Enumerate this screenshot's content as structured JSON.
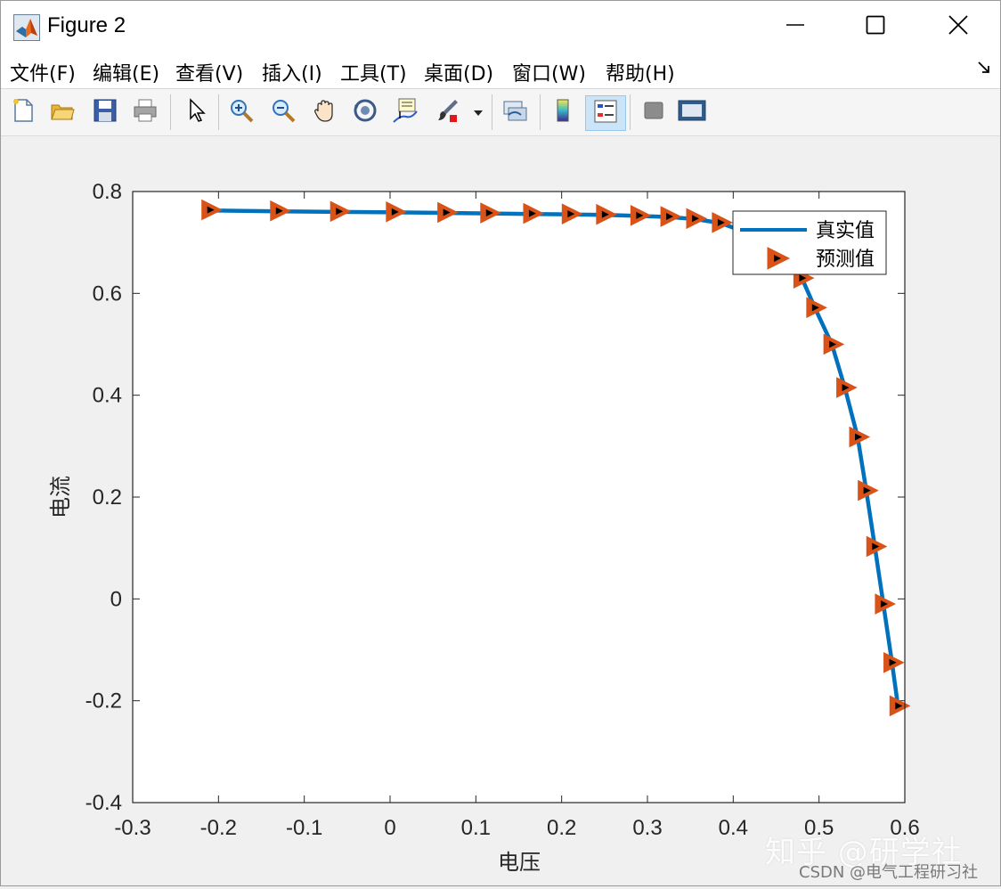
{
  "window": {
    "title": "Figure 2",
    "minimize_icon": "minimize-icon",
    "maximize_icon": "maximize-icon",
    "close_icon": "close-icon"
  },
  "menu": {
    "items": [
      "文件(F)",
      "编辑(E)",
      "查看(V)",
      "插入(I)",
      "工具(T)",
      "桌面(D)",
      "窗口(W)",
      "帮助(H)"
    ]
  },
  "toolbar": {
    "icons": [
      "new-figure-icon",
      "open-file-icon",
      "save-icon",
      "print-icon",
      "pointer-icon",
      "zoom-in-icon",
      "zoom-out-icon",
      "pan-icon",
      "rotate-3d-icon",
      "data-cursor-icon",
      "brush-icon",
      "link-plot-icon",
      "colorbar-icon",
      "legend-icon",
      "hide-plot-tools-icon",
      "show-plot-tools-icon"
    ]
  },
  "watermark": {
    "zhihu": "知乎 @研学社",
    "csdn": "CSDN @电气工程研习社"
  },
  "colors": {
    "line": "#0072BD",
    "marker_fill": "#D95319",
    "marker_inner": "#000000"
  },
  "chart_data": {
    "type": "line",
    "xlabel": "电压",
    "ylabel": "电流",
    "xlim": [
      -0.3,
      0.6
    ],
    "ylim": [
      -0.4,
      0.8
    ],
    "xticks": [
      "-0.3",
      "-0.2",
      "-0.1",
      "0",
      "0.1",
      "0.2",
      "0.3",
      "0.4",
      "0.5",
      "0.6"
    ],
    "yticks": [
      "-0.4",
      "-0.2",
      "0",
      "0.2",
      "0.4",
      "0.6",
      "0.8"
    ],
    "grid": false,
    "legend_position": "top-right",
    "series": [
      {
        "name": "真实值",
        "style": "line",
        "x": [
          -0.21,
          -0.13,
          -0.06,
          0.005,
          0.065,
          0.115,
          0.165,
          0.21,
          0.25,
          0.29,
          0.325,
          0.355,
          0.385,
          0.415,
          0.445,
          0.465,
          0.48,
          0.495,
          0.515,
          0.53,
          0.545,
          0.555,
          0.565,
          0.575,
          0.585,
          0.592
        ],
        "y": [
          0.763,
          0.761,
          0.76,
          0.759,
          0.758,
          0.757,
          0.756,
          0.755,
          0.754,
          0.752,
          0.75,
          0.746,
          0.738,
          0.72,
          0.695,
          0.665,
          0.63,
          0.572,
          0.5,
          0.415,
          0.318,
          0.213,
          0.103,
          -0.01,
          -0.125,
          -0.21
        ]
      },
      {
        "name": "预测值",
        "style": "marker",
        "x": [
          -0.21,
          -0.13,
          -0.06,
          0.005,
          0.065,
          0.115,
          0.165,
          0.21,
          0.25,
          0.29,
          0.325,
          0.355,
          0.385,
          0.48,
          0.495,
          0.515,
          0.53,
          0.545,
          0.555,
          0.565,
          0.575,
          0.585,
          0.592
        ],
        "y": [
          0.764,
          0.762,
          0.761,
          0.76,
          0.759,
          0.758,
          0.757,
          0.756,
          0.755,
          0.753,
          0.751,
          0.747,
          0.739,
          0.63,
          0.572,
          0.5,
          0.415,
          0.318,
          0.213,
          0.103,
          -0.01,
          -0.125,
          -0.21
        ]
      }
    ]
  }
}
